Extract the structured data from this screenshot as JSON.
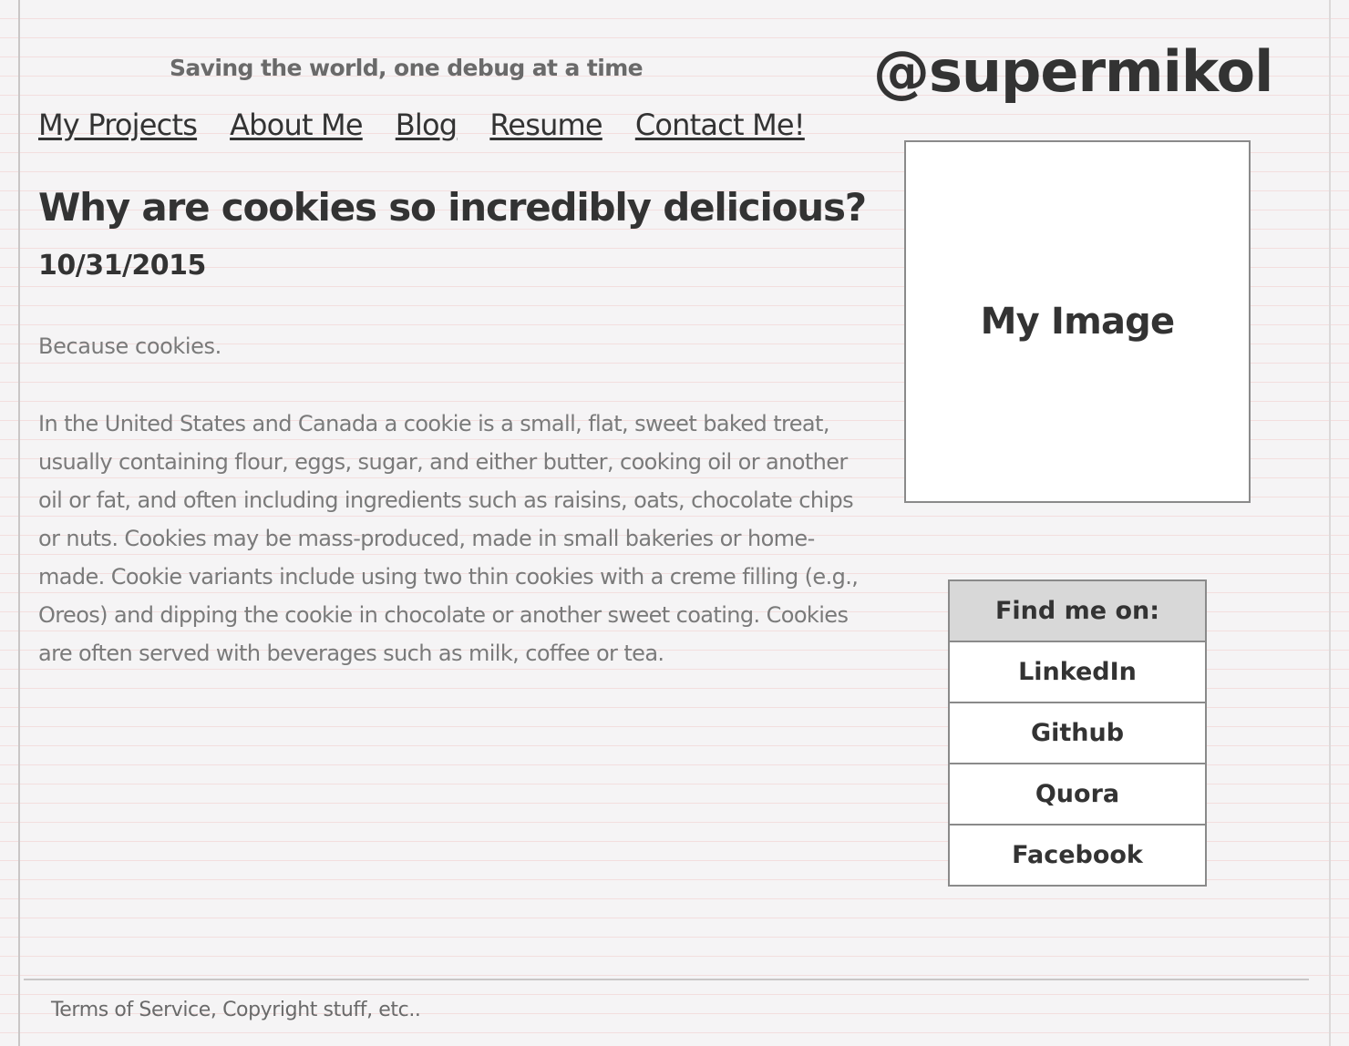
{
  "header": {
    "tagline": "Saving the world, one debug at a time",
    "handle": "@supermikol"
  },
  "nav": {
    "items": [
      {
        "label": "My Projects"
      },
      {
        "label": "About Me"
      },
      {
        "label": "Blog"
      },
      {
        "label": "Resume"
      },
      {
        "label": "Contact Me!"
      }
    ]
  },
  "post": {
    "title": "Why are cookies so incredibly delicious?",
    "date": "10/31/2015",
    "intro": "Because cookies.",
    "body": "In the United States and Canada a cookie is a small, flat, sweet baked treat, usually containing flour, eggs, sugar, and either butter, cooking oil or another oil or fat, and often including ingredients such as raisins, oats, chocolate chips or nuts. Cookies may be mass-produced, made in small bakeries or home-made. Cookie variants include using two thin cookies with a creme filling (e.g., Oreos) and dipping the cookie in chocolate or another sweet coating. Cookies are often served with beverages such as milk, coffee or tea."
  },
  "sidebar": {
    "image_placeholder": "My Image",
    "social": {
      "header": "Find me on:",
      "items": [
        {
          "label": "LinkedIn"
        },
        {
          "label": "Github"
        },
        {
          "label": "Quora"
        },
        {
          "label": "Facebook"
        }
      ]
    }
  },
  "footer": {
    "text": "Terms of Service, Copyright stuff, etc.."
  },
  "colors": {
    "background": "#f5f4f5",
    "ruled_line": "#f3dede",
    "text_dark": "#333333",
    "text_muted": "#7a7a7a",
    "border": "#8a8a8a",
    "social_header_bg": "#d8d8d8"
  }
}
